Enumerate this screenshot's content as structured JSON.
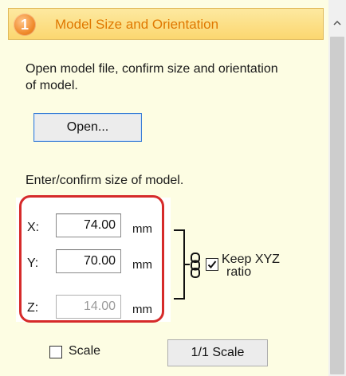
{
  "panel": {
    "step_number": "1",
    "title": "Model Size and Orientation",
    "description": "Open model file, confirm size and orientation of model.",
    "open_button": "Open...",
    "size_label": "Enter/confirm size of model.",
    "fields": {
      "x": {
        "label": "X:",
        "value": "74.00",
        "unit": "mm"
      },
      "y": {
        "label": "Y:",
        "value": "70.00",
        "unit": "mm"
      },
      "z": {
        "label": "Z:",
        "value": "14.00",
        "unit": "mm"
      }
    },
    "keep_ratio": {
      "label_line1": "Keep XYZ",
      "label_line2": "ratio",
      "checked": true
    },
    "scale": {
      "label": "Scale",
      "checked": false
    },
    "scale_button": "1/1 Scale"
  },
  "colors": {
    "panel_background": "#fdfde3",
    "header_gradient": "#fbd770",
    "title_text": "#e07800",
    "highlight": "#d62a2a",
    "focus_border": "#3c7fd6"
  },
  "icons": {
    "step_badge": "orange-circle-number",
    "chain": "chain-link-icon",
    "scroll_up": "chevron-up-icon"
  }
}
